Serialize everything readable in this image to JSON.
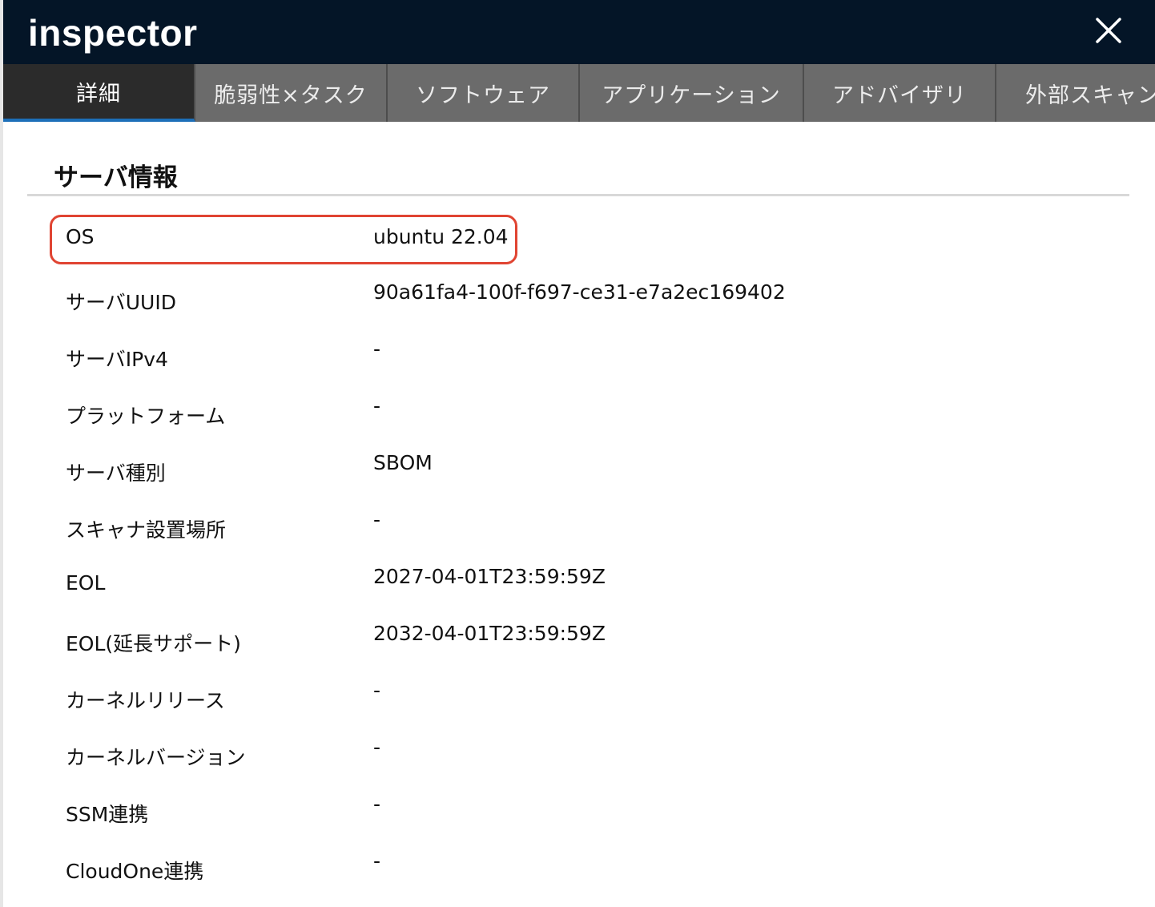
{
  "window": {
    "title": "inspector",
    "close_icon": "close-icon"
  },
  "tabs": [
    {
      "label": "詳細",
      "active": true
    },
    {
      "label": "脆弱性×タスク",
      "active": false
    },
    {
      "label": "ソフトウェア",
      "active": false
    },
    {
      "label": "アプリケーション",
      "active": false
    },
    {
      "label": "アドバイザリ",
      "active": false
    },
    {
      "label": "外部スキャン",
      "active": false
    }
  ],
  "section": {
    "title": "サーバ情報"
  },
  "rows": [
    {
      "label": "OS",
      "value": "ubuntu 22.04"
    },
    {
      "label": "サーバUUID",
      "value": "90a61fa4-100f-f697-ce31-e7a2ec169402"
    },
    {
      "label": "サーバIPv4",
      "value": "-"
    },
    {
      "label": "プラットフォーム",
      "value": "-"
    },
    {
      "label": "サーバ種別",
      "value": "SBOM"
    },
    {
      "label": "スキャナ設置場所",
      "value": "-"
    },
    {
      "label": "EOL",
      "value": "2027-04-01T23:59:59Z"
    },
    {
      "label": "EOL(延長サポート)",
      "value": "2032-04-01T23:59:59Z"
    },
    {
      "label": "カーネルリリース",
      "value": "-"
    },
    {
      "label": "カーネルバージョン",
      "value": "-"
    },
    {
      "label": "SSM連携",
      "value": "-"
    },
    {
      "label": "CloudOne連携",
      "value": "-"
    }
  ],
  "colors": {
    "titlebar": "#041527",
    "tabbar": "#6b6b6b",
    "active_tab": "#2b2b2b",
    "highlight": "#e04432"
  }
}
